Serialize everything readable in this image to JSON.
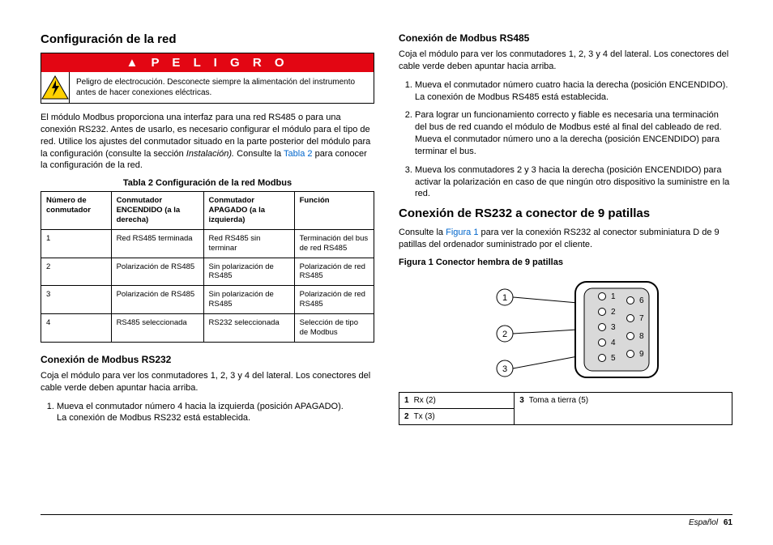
{
  "left": {
    "heading": "Configuración de la red",
    "danger_title": "P E L I G R O",
    "danger_text": "Peligro de electrocución. Desconecte siempre la alimentación del instrumento antes de hacer conexiones eléctricas.",
    "intro_a": "El módulo Modbus proporciona una interfaz para una red RS485 o para una conexión RS232. Antes de usarlo, es necesario configurar el módulo para el tipo de red. Utilice los ajustes del conmutador situado en la parte posterior del módulo para la configuración (consulte la sección ",
    "intro_inst": "Instalación).",
    "intro_b": " Consulte la ",
    "intro_link": "Tabla 2",
    "intro_c": " para conocer la configuración de la red.",
    "table_caption": "Tabla 2  Configuración de la red Modbus",
    "th1": "Número de conmutador",
    "th2": "Conmutador ENCENDIDO (a la derecha)",
    "th3": "Conmutador APAGADO (a la izquierda)",
    "th4": "Función",
    "rows": [
      {
        "c1": "1",
        "c2": "Red RS485 terminada",
        "c3": "Red RS485 sin terminar",
        "c4": "Terminación del bus de red RS485"
      },
      {
        "c1": "2",
        "c2": "Polarización de RS485",
        "c3": "Sin polarización de RS485",
        "c4": "Polarización de red RS485"
      },
      {
        "c1": "3",
        "c2": "Polarización de RS485",
        "c3": "Sin polarización de RS485",
        "c4": "Polarización de red RS485"
      },
      {
        "c1": "4",
        "c2": "RS485 seleccionada",
        "c3": "RS232 seleccionada",
        "c4": "Selección de tipo de Modbus"
      }
    ],
    "h3_rs232": "Conexión de Modbus RS232",
    "rs232_p": "Coja el módulo para ver los conmutadores 1, 2, 3 y 4 del lateral. Los conectores del cable verde deben apuntar hacia arriba.",
    "rs232_li1a": "Mueva el conmutador número 4 hacia la izquierda (posición APAGADO).",
    "rs232_li1b": "La conexión de Modbus RS232 está establecida."
  },
  "right": {
    "h3_rs485": "Conexión de Modbus RS485",
    "rs485_p": "Coja el módulo para ver los conmutadores 1, 2, 3 y 4 del lateral. Los conectores del cable verde deben apuntar hacia arriba.",
    "li1a": "Mueva el conmutador número cuatro hacia la derecha (posición ENCENDIDO).",
    "li1b": "La conexión de Modbus RS485 está establecida.",
    "li2": "Para lograr un funcionamiento correcto y fiable es necesaria una terminación del bus de red cuando el módulo de Modbus esté al final del cableado de red. Mueva el conmutador número uno a la derecha (posición ENCENDIDO) para terminar el bus.",
    "li3": "Mueva los conmutadores 2 y 3 hacia la derecha (posición ENCENDIDO) para activar la polarización en caso de que ningún otro dispositivo la suministre en la red.",
    "h2_9pin": "Conexión de RS232 a conector de 9 patillas",
    "p9a": "Consulte la ",
    "p9link": "Figura 1",
    "p9b": " para ver la conexión RS232 al conector subminiatura D de 9 patillas del ordenador suministrado por el cliente.",
    "fig_caption": "Figura 1   Conector hembra de 9 patillas",
    "pin1n": "1",
    "pin1t": "Rx (2)",
    "pin2n": "2",
    "pin2t": "Tx (3)",
    "pin3n": "3",
    "pin3t": "Toma a tierra (5)"
  },
  "footer": {
    "lang": "Español",
    "page": "61"
  }
}
